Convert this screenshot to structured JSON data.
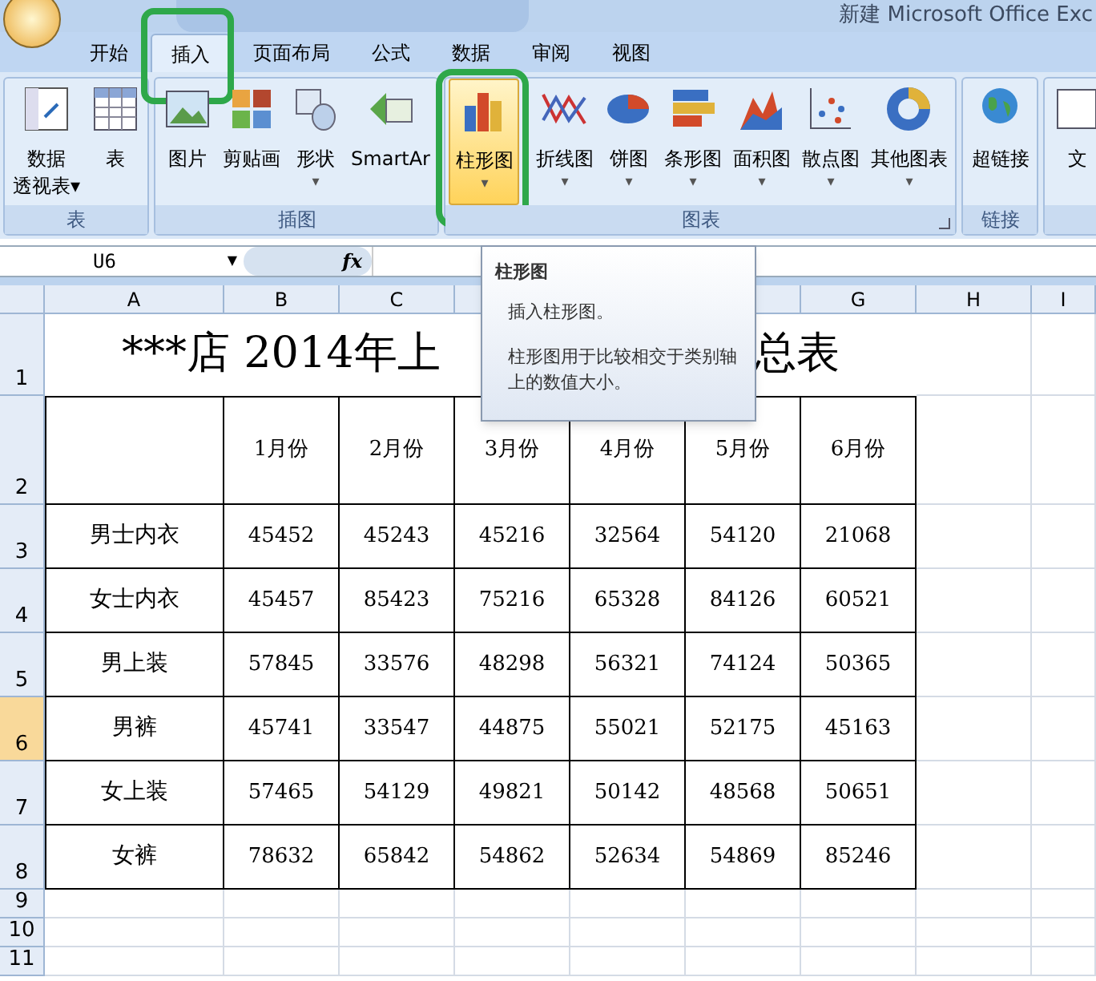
{
  "window": {
    "title": "新建 Microsoft Office Exc"
  },
  "tabs": [
    {
      "label": "开始",
      "selected": false,
      "circled": false
    },
    {
      "label": "插入",
      "selected": true,
      "circled": true
    },
    {
      "label": "页面布局",
      "selected": false,
      "circled": false
    },
    {
      "label": "公式",
      "selected": false,
      "circled": false
    },
    {
      "label": "数据",
      "selected": false,
      "circled": false
    },
    {
      "label": "审阅",
      "selected": false,
      "circled": false
    },
    {
      "label": "视图",
      "selected": false,
      "circled": false
    }
  ],
  "ribbon_groups": [
    {
      "label": "表",
      "buttons": [
        {
          "kind": "pivot",
          "label": "数据",
          "label2": "透视表",
          "caret": "▾",
          "hovered": false,
          "circled": false
        },
        {
          "kind": "table",
          "label": "表",
          "hovered": false,
          "circled": false
        }
      ]
    },
    {
      "label": "插图",
      "buttons": [
        {
          "kind": "image",
          "label": "图片",
          "hovered": false,
          "circled": false
        },
        {
          "kind": "clipart",
          "label": "剪贴画",
          "hovered": false,
          "circled": false
        },
        {
          "kind": "shapes",
          "label": "形状",
          "caret": "▾",
          "hovered": false,
          "circled": false
        },
        {
          "kind": "smartart",
          "label": "SmartAr",
          "hovered": false,
          "circled": false
        }
      ]
    },
    {
      "label": "图表",
      "launcher": true,
      "buttons": [
        {
          "kind": "column",
          "label": "柱形图",
          "caret": "▾",
          "hovered": true,
          "circled": true
        },
        {
          "kind": "line",
          "label": "折线图",
          "caret": "▾",
          "hovered": false,
          "circled": false
        },
        {
          "kind": "pie",
          "label": "饼图",
          "caret": "▾",
          "hovered": false,
          "circled": false
        },
        {
          "kind": "bar",
          "label": "条形图",
          "caret": "▾",
          "hovered": false,
          "circled": false
        },
        {
          "kind": "area",
          "label": "面积图",
          "caret": "▾",
          "hovered": false,
          "circled": false
        },
        {
          "kind": "scatter",
          "label": "散点图",
          "caret": "▾",
          "hovered": false,
          "circled": false
        },
        {
          "kind": "donut",
          "label": "其他图表",
          "caret": "▾",
          "hovered": false,
          "circled": false
        }
      ]
    },
    {
      "label": "链接",
      "buttons": [
        {
          "kind": "globe",
          "label": "超链接",
          "hovered": false,
          "circled": false
        }
      ]
    },
    {
      "buttons": [
        {
          "kind": "text",
          "label": "文",
          "hovered": false,
          "circled": false
        }
      ]
    }
  ],
  "formula_bar": {
    "name_box": "U6",
    "dropdown": "▼",
    "fx": "fx"
  },
  "tooltip": {
    "title": "柱形图",
    "line1": "插入柱形图。",
    "line2": "柱形图用于比较相交于类别轴上的数值大小。"
  },
  "columns": [
    {
      "label": "A"
    },
    {
      "label": "B"
    },
    {
      "label": "C"
    },
    {},
    {},
    {},
    {
      "label": "G"
    },
    {
      "label": "H"
    },
    {
      "label": "I"
    }
  ],
  "sheet": {
    "title_left": "***店 2014年上",
    "title_right": "总表",
    "months": [
      "1月份",
      "2月份",
      "3月份",
      "4月份",
      "5月份",
      "6月份"
    ],
    "rows": [
      [
        "男士内衣",
        "45452",
        "45243",
        "45216",
        "32564",
        "54120",
        "21068"
      ],
      [
        "女士内衣",
        "45457",
        "85423",
        "75216",
        "65328",
        "84126",
        "60521"
      ],
      [
        "男上装",
        "57845",
        "33576",
        "48298",
        "56321",
        "74124",
        "50365"
      ],
      [
        "男裤",
        "45741",
        "33547",
        "44875",
        "55021",
        "52175",
        "45163"
      ],
      [
        "女上装",
        "57465",
        "54129",
        "49821",
        "50142",
        "48568",
        "50651"
      ],
      [
        "女裤",
        "78632",
        "65842",
        "54862",
        "52634",
        "54869",
        "85246"
      ]
    ]
  },
  "row_headers": [
    {
      "label": "1",
      "selected": false
    },
    {
      "label": "2",
      "selected": false
    },
    {
      "label": "3",
      "selected": false
    },
    {
      "label": "4",
      "selected": false
    },
    {
      "label": "5",
      "selected": false
    },
    {
      "label": "6",
      "selected": true
    },
    {
      "label": "7",
      "selected": false
    },
    {
      "label": "8",
      "selected": false
    },
    {
      "label": "9",
      "selected": false
    },
    {
      "label": "10",
      "selected": false
    },
    {
      "label": "11",
      "selected": false
    }
  ]
}
